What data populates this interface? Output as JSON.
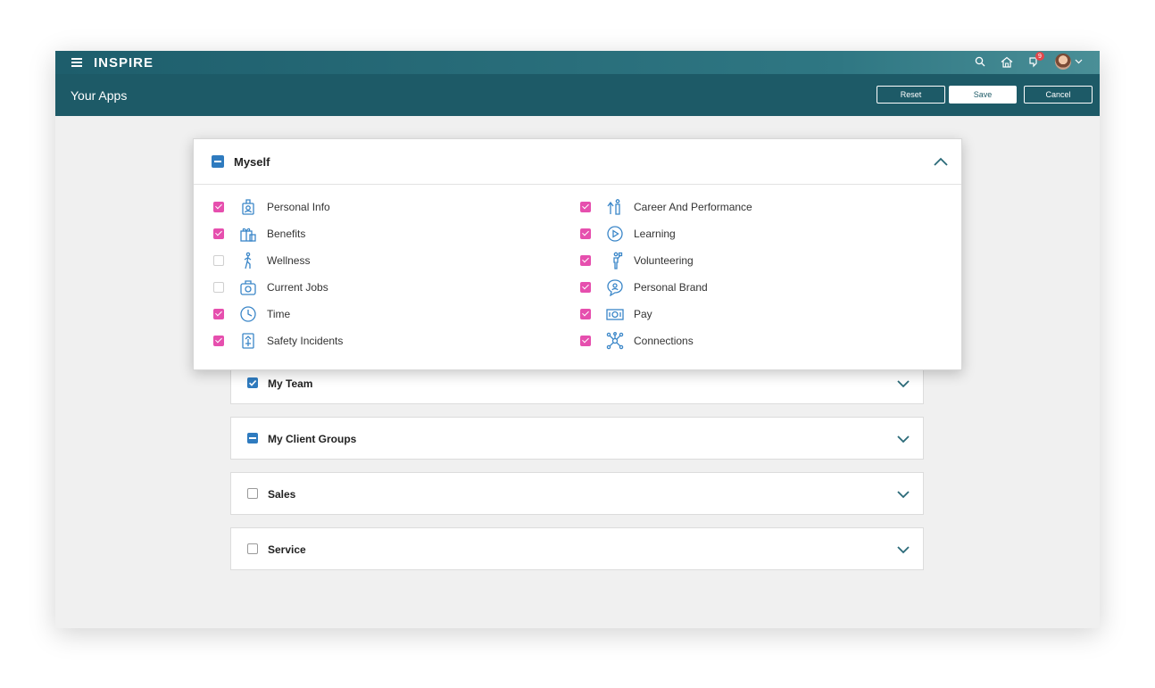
{
  "header": {
    "logo": "INSPIRE",
    "notification_count": "9",
    "icons": [
      "search-icon",
      "home-icon",
      "notification-icon",
      "avatar",
      "chevron-down-icon"
    ]
  },
  "subheader": {
    "title": "Your Apps",
    "reset_label": "Reset",
    "save_label": "Save",
    "cancel_label": "Cancel"
  },
  "myself": {
    "title": "Myself",
    "state": "indeterminate",
    "apps_left": [
      {
        "label": "Personal Info",
        "checked": true,
        "icon": "badge-icon"
      },
      {
        "label": "Benefits",
        "checked": true,
        "icon": "gift-icon"
      },
      {
        "label": "Wellness",
        "checked": false,
        "icon": "runner-icon"
      },
      {
        "label": "Current Jobs",
        "checked": false,
        "icon": "briefcase-icon"
      },
      {
        "label": "Time",
        "checked": true,
        "icon": "clock-icon"
      },
      {
        "label": "Safety Incidents",
        "checked": true,
        "icon": "safety-icon"
      }
    ],
    "apps_right": [
      {
        "label": "Career And Performance",
        "checked": true,
        "icon": "career-icon"
      },
      {
        "label": "Learning",
        "checked": true,
        "icon": "play-icon"
      },
      {
        "label": "Volunteering",
        "checked": true,
        "icon": "volunteer-icon"
      },
      {
        "label": "Personal Brand",
        "checked": true,
        "icon": "speech-icon"
      },
      {
        "label": "Pay",
        "checked": true,
        "icon": "money-icon"
      },
      {
        "label": "Connections",
        "checked": true,
        "icon": "network-icon"
      }
    ]
  },
  "sections": [
    {
      "label": "My Team",
      "state": "checked"
    },
    {
      "label": "My Client Groups",
      "state": "indeterminate"
    },
    {
      "label": "Sales",
      "state": "unchecked"
    },
    {
      "label": "Service",
      "state": "unchecked"
    }
  ],
  "colors": {
    "header_dark": "#1d5a67",
    "checkbox_blue": "#2f7bbf",
    "checkbox_pink": "#e64fae",
    "icon_blue": "#3a86c8"
  }
}
